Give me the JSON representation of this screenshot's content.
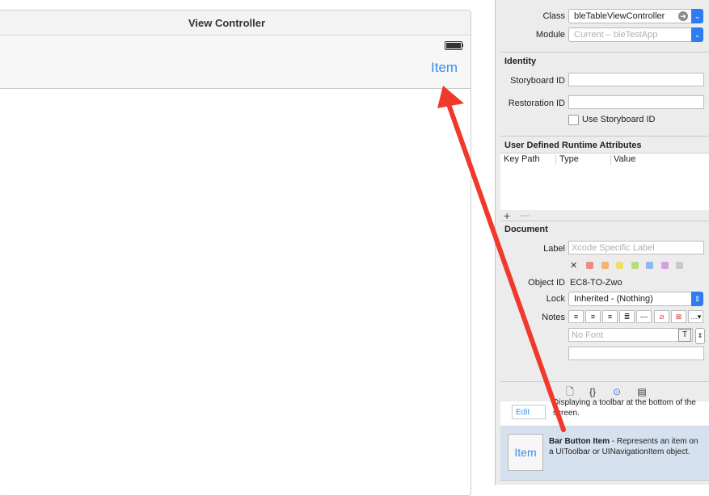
{
  "canvas": {
    "title": "View Controller",
    "nav_item_label": "Item"
  },
  "inspector": {
    "custom_class": {
      "class_label": "Class",
      "class_value": "bleTableViewController",
      "module_label": "Module",
      "module_value": "Current – bleTestApp"
    },
    "identity": {
      "title": "Identity",
      "storyboard_id_label": "Storyboard ID",
      "storyboard_id_value": "",
      "restoration_id_label": "Restoration ID",
      "restoration_id_value": "",
      "use_storyboard_id_label": "Use Storyboard ID",
      "use_storyboard_id_checked": false
    },
    "runtime_attributes": {
      "title": "User Defined Runtime Attributes",
      "columns": [
        "Key Path",
        "Type",
        "Value"
      ],
      "add_symbol": "+",
      "remove_symbol": "—"
    },
    "document": {
      "title": "Document",
      "label_label": "Label",
      "label_placeholder": "Xcode Specific Label",
      "clear_symbol": "✕",
      "label_colors": [
        "#f08a8a",
        "#f2b56b",
        "#eedf6b",
        "#b7dc7a",
        "#8fb8ef",
        "#d6a0e0",
        "#c9c9c9"
      ],
      "object_id_label": "Object ID",
      "object_id_value": "EC8-TO-Zwo",
      "lock_label": "Lock",
      "lock_value": "Inherited - (Nothing)",
      "notes_label": "Notes",
      "font_placeholder": "No Font"
    }
  },
  "tabs": [
    {
      "name": "file-icon",
      "glyph": "🗋"
    },
    {
      "name": "braces-icon",
      "glyph": "{}"
    },
    {
      "name": "object-library-icon",
      "glyph": "⊙"
    },
    {
      "name": "media-library-icon",
      "glyph": "▤"
    }
  ],
  "library": {
    "toolbar_entry": {
      "button_label": "Edit",
      "description": "Displaying a toolbar at the bottom of the screen."
    },
    "bar_button_entry": {
      "icon_label": "Item",
      "name": "Bar Button Item",
      "description": " - Represents an item on a UIToolbar or UINavigationItem object."
    }
  },
  "colors": {
    "accent": "#2f7cf0",
    "link_blue": "#3a8ee6",
    "annotation_arrow": "#f0392b"
  }
}
